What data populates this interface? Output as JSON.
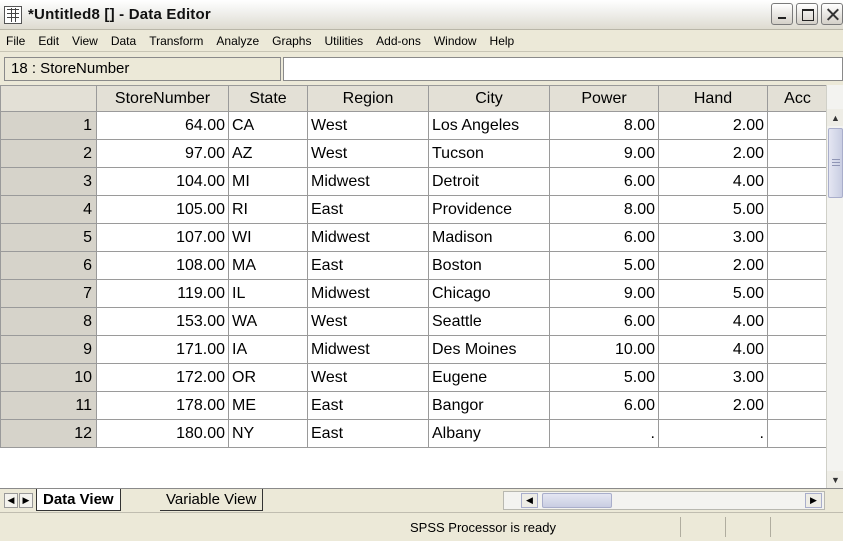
{
  "window": {
    "title": "*Untitled8 [] - Data Editor"
  },
  "menu": [
    "File",
    "Edit",
    "View",
    "Data",
    "Transform",
    "Analyze",
    "Graphs",
    "Utilities",
    "Add-ons",
    "Window",
    "Help"
  ],
  "cell_bar": {
    "reference": "18 : StoreNumber",
    "value": ""
  },
  "grid": {
    "columns": [
      "StoreNumber",
      "State",
      "Region",
      "City",
      "Power",
      "Hand",
      "Acc"
    ],
    "rows": [
      {
        "n": "1",
        "StoreNumber": "64.00",
        "State": "CA",
        "Region": "West",
        "City": "Los Angeles",
        "Power": "8.00",
        "Hand": "2.00",
        "Acc": ""
      },
      {
        "n": "2",
        "StoreNumber": "97.00",
        "State": "AZ",
        "Region": "West",
        "City": "Tucson",
        "Power": "9.00",
        "Hand": "2.00",
        "Acc": ""
      },
      {
        "n": "3",
        "StoreNumber": "104.00",
        "State": "MI",
        "Region": "Midwest",
        "City": "Detroit",
        "Power": "6.00",
        "Hand": "4.00",
        "Acc": ""
      },
      {
        "n": "4",
        "StoreNumber": "105.00",
        "State": "RI",
        "Region": "East",
        "City": "Providence",
        "Power": "8.00",
        "Hand": "5.00",
        "Acc": ""
      },
      {
        "n": "5",
        "StoreNumber": "107.00",
        "State": "WI",
        "Region": "Midwest",
        "City": "Madison",
        "Power": "6.00",
        "Hand": "3.00",
        "Acc": ""
      },
      {
        "n": "6",
        "StoreNumber": "108.00",
        "State": "MA",
        "Region": "East",
        "City": "Boston",
        "Power": "5.00",
        "Hand": "2.00",
        "Acc": ""
      },
      {
        "n": "7",
        "StoreNumber": "119.00",
        "State": "IL",
        "Region": "Midwest",
        "City": "Chicago",
        "Power": "9.00",
        "Hand": "5.00",
        "Acc": ""
      },
      {
        "n": "8",
        "StoreNumber": "153.00",
        "State": "WA",
        "Region": "West",
        "City": "Seattle",
        "Power": "6.00",
        "Hand": "4.00",
        "Acc": ""
      },
      {
        "n": "9",
        "StoreNumber": "171.00",
        "State": "IA",
        "Region": "Midwest",
        "City": "Des Moines",
        "Power": "10.00",
        "Hand": "4.00",
        "Acc": ""
      },
      {
        "n": "10",
        "StoreNumber": "172.00",
        "State": "OR",
        "Region": "West",
        "City": "Eugene",
        "Power": "5.00",
        "Hand": "3.00",
        "Acc": ""
      },
      {
        "n": "11",
        "StoreNumber": "178.00",
        "State": "ME",
        "Region": "East",
        "City": "Bangor",
        "Power": "6.00",
        "Hand": "2.00",
        "Acc": ""
      },
      {
        "n": "12",
        "StoreNumber": "180.00",
        "State": "NY",
        "Region": "East",
        "City": "Albany",
        "Power": ".",
        "Hand": ".",
        "Acc": ""
      }
    ]
  },
  "tabs": {
    "active": "Data View",
    "inactive": "Variable View"
  },
  "status": {
    "text": "SPSS Processor is ready"
  },
  "icons": {
    "app": "spreadsheet-icon",
    "minimize": "minimize-icon",
    "maximize": "maximize-icon",
    "close": "close-icon"
  }
}
